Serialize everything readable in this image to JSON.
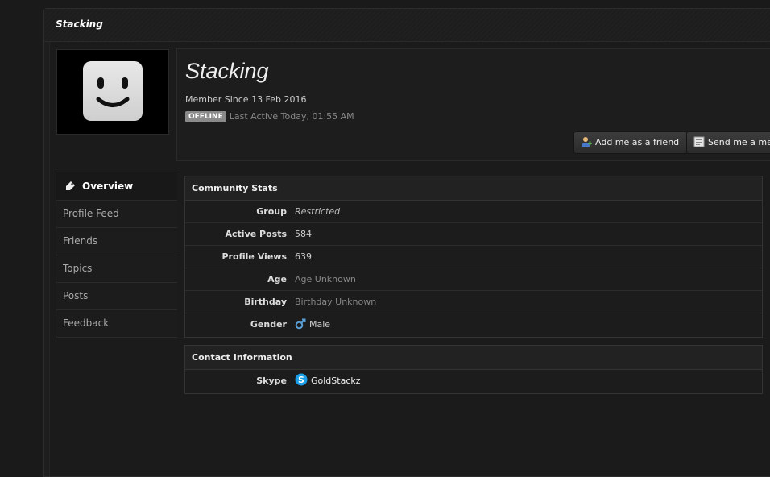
{
  "page": {
    "title": "Stacking"
  },
  "profile": {
    "name": "Stacking",
    "member_since": "Member Since 13 Feb 2016",
    "status_badge": "OFFLINE",
    "last_active": "Last Active Today, 01:55 AM",
    "add_friend_label": "Add me as a friend",
    "send_message_label": "Send me a mess"
  },
  "nav": {
    "items": [
      {
        "label": "Overview",
        "active": true
      },
      {
        "label": "Profile Feed"
      },
      {
        "label": "Friends"
      },
      {
        "label": "Topics"
      },
      {
        "label": "Posts"
      },
      {
        "label": "Feedback"
      }
    ]
  },
  "community_stats": {
    "title": "Community Stats",
    "rows": [
      {
        "label": "Group",
        "value": "Restricted"
      },
      {
        "label": "Active Posts",
        "value": "584"
      },
      {
        "label": "Profile Views",
        "value": "639"
      },
      {
        "label": "Age",
        "value": "Age Unknown"
      },
      {
        "label": "Birthday",
        "value": "Birthday Unknown"
      },
      {
        "label": "Gender",
        "value": "Male",
        "icon": "male-icon"
      }
    ]
  },
  "contact": {
    "title": "Contact Information",
    "rows": [
      {
        "label": "Skype",
        "value": "GoldStackz",
        "icon": "skype-icon"
      }
    ]
  },
  "colors": {
    "background": "#1a1a1a",
    "skype": "#1a9ee8",
    "male": "#5aa0d8"
  }
}
